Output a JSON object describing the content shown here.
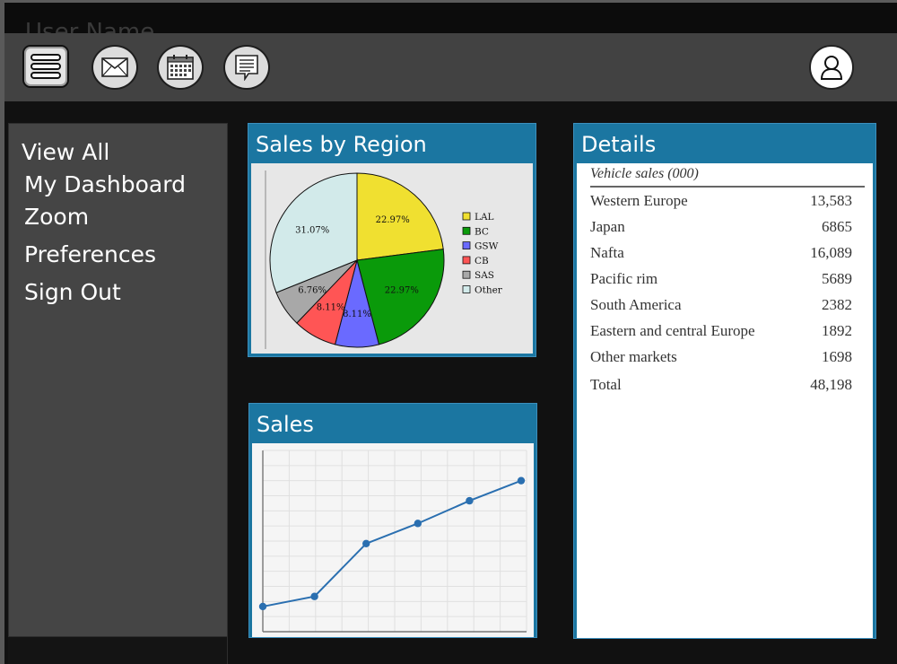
{
  "header": {
    "ghost_text": "User Name"
  },
  "toolbar": {
    "buttons": [
      {
        "name": "menu",
        "icon": "hamburger-icon"
      },
      {
        "name": "mail",
        "icon": "envelope-icon"
      },
      {
        "name": "calendar",
        "icon": "calendar-icon"
      },
      {
        "name": "notes",
        "icon": "document-icon"
      }
    ],
    "profile_icon": "user-icon"
  },
  "sidebar": {
    "items": [
      {
        "label": "View All"
      },
      {
        "label": "My Dashboard"
      },
      {
        "label": "Zoom"
      },
      {
        "label": "Preferences"
      },
      {
        "label": "Sign Out"
      }
    ]
  },
  "panels": {
    "region": {
      "title": "Sales by Region"
    },
    "sales": {
      "title": "Sales"
    },
    "details": {
      "title": "Details"
    }
  },
  "details": {
    "caption": "Vehicle sales (000)",
    "rows": [
      {
        "label": "Western Europe",
        "value": "13,583"
      },
      {
        "label": "Japan",
        "value": "6865"
      },
      {
        "label": "Nafta",
        "value": "16,089"
      },
      {
        "label": "Pacific rim",
        "value": "5689"
      },
      {
        "label": "South America",
        "value": "2382"
      },
      {
        "label": "Eastern and central Europe",
        "value": "1892"
      },
      {
        "label": "Other markets",
        "value": "1698"
      },
      {
        "label": "Total",
        "value": "48,198"
      }
    ]
  },
  "colors": {
    "panel_header": "#1b76a1",
    "sidebar": "#454545",
    "toolbar": "#424242",
    "line": "#2a6fb0"
  },
  "chart_data": [
    {
      "type": "pie",
      "categories": [
        "LAL",
        "BC",
        "GSW",
        "CB",
        "SAS",
        "Other"
      ],
      "values": [
        22.97,
        22.97,
        8.11,
        8.11,
        6.76,
        31.07
      ],
      "labels": [
        "22.97%",
        "22.97%",
        "8.11%",
        "8.11%",
        "6.76%",
        "31.07%"
      ],
      "colors": [
        "#f0e030",
        "#0a9a0a",
        "#6a6aff",
        "#ff5555",
        "#a8a8a8",
        "#d2eaea"
      ],
      "legend": "right"
    },
    {
      "type": "line",
      "x": [
        1,
        2,
        3,
        4,
        5,
        6
      ],
      "values": [
        10,
        14,
        35,
        43,
        52,
        60
      ],
      "ylim": [
        0,
        72
      ],
      "grid": true
    }
  ]
}
